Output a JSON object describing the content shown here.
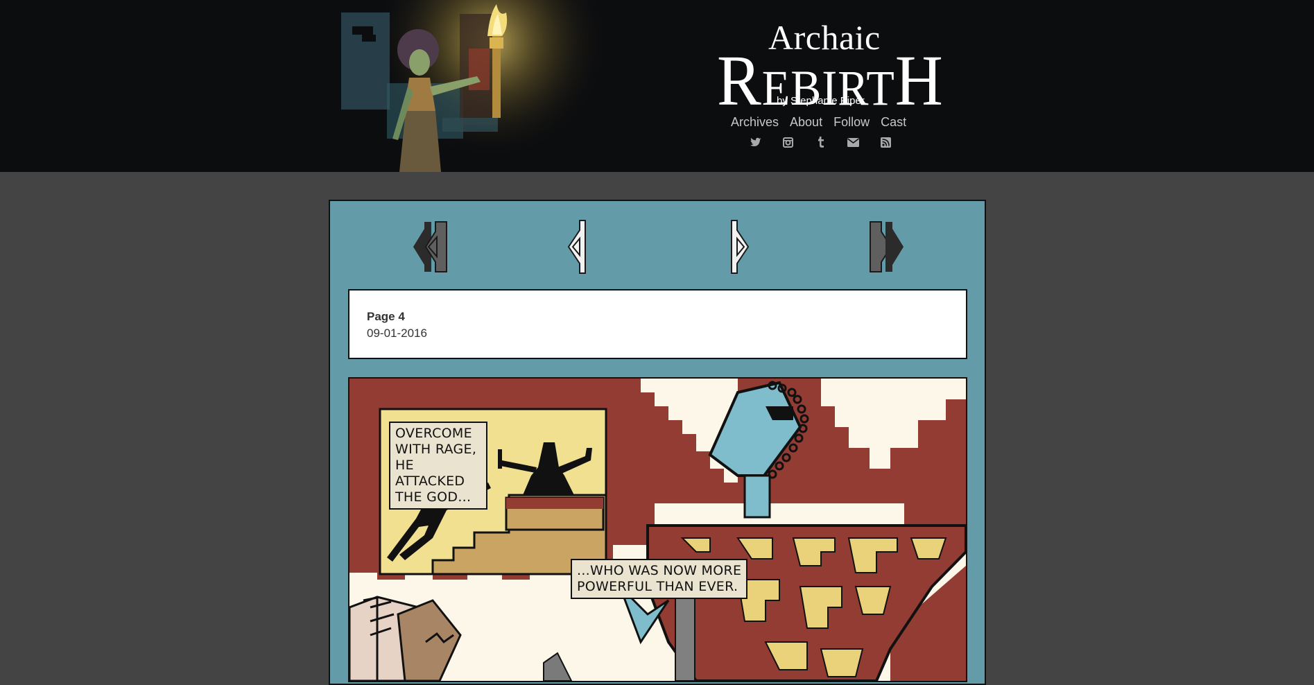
{
  "header": {
    "logo": {
      "line1": "Archaic",
      "line2_cap_r": "R",
      "line2_small": "EBIRT",
      "line2_cap_h": "H"
    },
    "byline": "by Stephanie Piper",
    "nav": [
      "Archives",
      "About",
      "Follow",
      "Cast"
    ],
    "social_icons": [
      "twitter-icon",
      "instagram-icon",
      "tumblr-icon",
      "email-icon",
      "rss-icon"
    ]
  },
  "comic_nav": {
    "buttons": [
      "first-page-button",
      "previous-page-button",
      "next-page-button",
      "last-page-button"
    ]
  },
  "page_info": {
    "title": "Page 4",
    "date": "09-01-2016"
  },
  "comic": {
    "caption1": [
      "OVERCOME",
      "WITH RAGE,",
      "HE ATTACKED",
      "THE GOD..."
    ],
    "caption2": [
      "...WHO WAS NOW MORE",
      "POWERFUL THAN EVER."
    ]
  },
  "colors": {
    "header_bg": "#0c0d0f",
    "page_bg": "#444444",
    "panel_bg": "#649ba9",
    "nav_link": "#c8c8c8",
    "comic_red": "#933c33",
    "comic_yellow": "#f0e08f",
    "comic_blue": "#7fbccc"
  }
}
